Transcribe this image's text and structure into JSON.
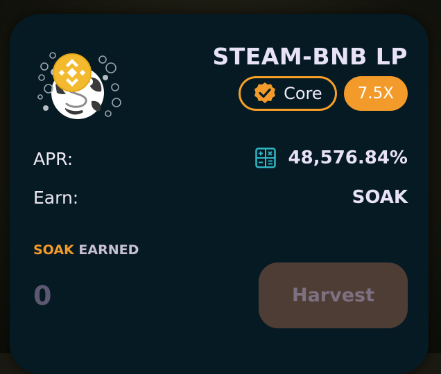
{
  "farm": {
    "title": "STEAM-BNB LP",
    "core_label": "Core",
    "multiplier": "7.5X"
  },
  "stats": {
    "apr_label": "APR:",
    "apr_value": "48,576.84%",
    "earn_label": "Earn:",
    "earn_value": "SOAK"
  },
  "earned": {
    "token": "SOAK",
    "word": "EARNED",
    "amount": "0"
  },
  "actions": {
    "harvest_label": "Harvest"
  },
  "icons": {
    "logo": "steam-bnb-pair-icon",
    "core": "verified-badge-icon",
    "apr": "calculator-icon"
  },
  "colors": {
    "card_bg": "#061a23",
    "accent": "#f39b2a",
    "text": "#e8e2f7",
    "harvest_disabled": "#4e3d35",
    "calculator": "#2fb8c6"
  }
}
